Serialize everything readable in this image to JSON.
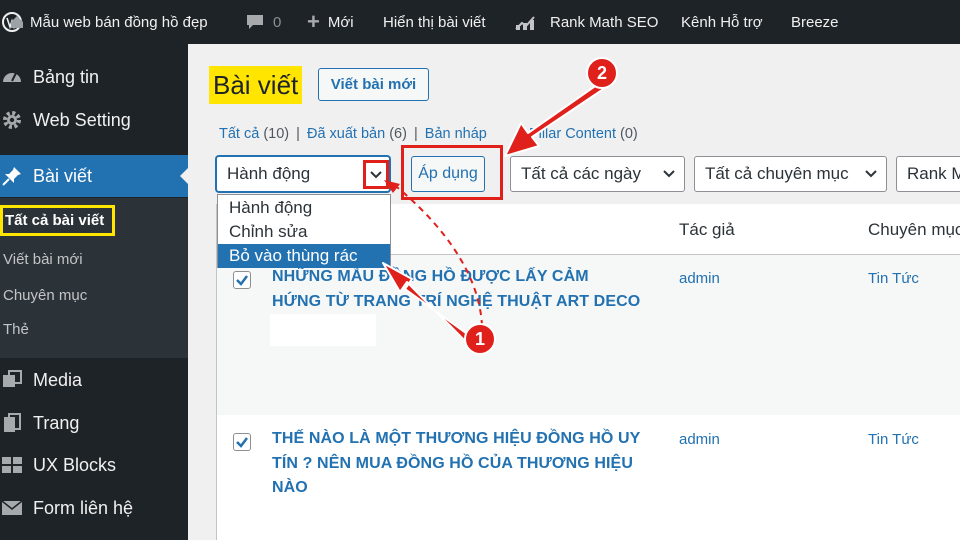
{
  "adminbar": {
    "site_name": "Mẫu web bán đồng hồ đẹp",
    "comments_count": "0",
    "new_label": "Mới",
    "view_posts": "Hiển thị bài viết",
    "rank_math": "Rank Math SEO",
    "support": "Kênh Hỗ trợ",
    "breeze": "Breeze"
  },
  "sidebar": {
    "items": [
      {
        "label": "Bảng tin",
        "icon": "dashboard-icon"
      },
      {
        "label": "Web Setting",
        "icon": "gear-icon"
      },
      {
        "label": "Bài viết",
        "icon": "pushpin-icon"
      },
      {
        "label": "Media",
        "icon": "media-icon"
      },
      {
        "label": "Trang",
        "icon": "pages-icon"
      },
      {
        "label": "UX Blocks",
        "icon": "blocks-icon"
      },
      {
        "label": "Form liên hệ",
        "icon": "mail-icon"
      }
    ],
    "submenu": [
      "Tất cả bài viết",
      "Viết bài mới",
      "Chuyên mục",
      "Thẻ"
    ]
  },
  "main": {
    "title": "Bài viết",
    "add_new": "Viết bài mới",
    "filters": {
      "all": "Tất cả",
      "all_count": "(10)",
      "published": "Đã xuất bản",
      "published_count": "(6)",
      "draft": "Bản nháp",
      "pillar": "Pillar Content",
      "pillar_count": "(0)"
    },
    "bulk_action": "Hành động",
    "apply": "Áp dụng",
    "dates": "Tất cả các ngày",
    "categories": "Tất cả chuyên mục",
    "rank": "Rank M",
    "dropdown_options": [
      "Hành động",
      "Chỉnh sửa",
      "Bỏ vào thùng rác"
    ],
    "columns": {
      "author": "Tác giả",
      "category": "Chuyên mục"
    },
    "rows": [
      {
        "title_line1": "NHỮNG MẪU ĐỒNG HỒ ĐƯỢC LẤY CẢM",
        "title_line2": "HỨNG TỪ TRANG TRÍ NGHỆ THUẬT ART DECO",
        "title_line3": "",
        "author": "admin",
        "category": "Tin Tức"
      },
      {
        "title_line1": "THẾ NÀO LÀ MỘT THƯƠNG HIỆU ĐỒNG HỒ UY",
        "title_line2": "TÍN ? NÊN MUA ĐỒNG HỒ CỦA THƯƠNG HIỆU",
        "title_line3": "NÀO",
        "author": "admin",
        "category": "Tin Tức"
      }
    ]
  },
  "annotations": {
    "step1": "1",
    "step2": "2"
  },
  "colors": {
    "accent": "#2271b1",
    "highlight": "#ffe500",
    "annotation": "#e0201b",
    "adminbar": "#1d2327"
  }
}
